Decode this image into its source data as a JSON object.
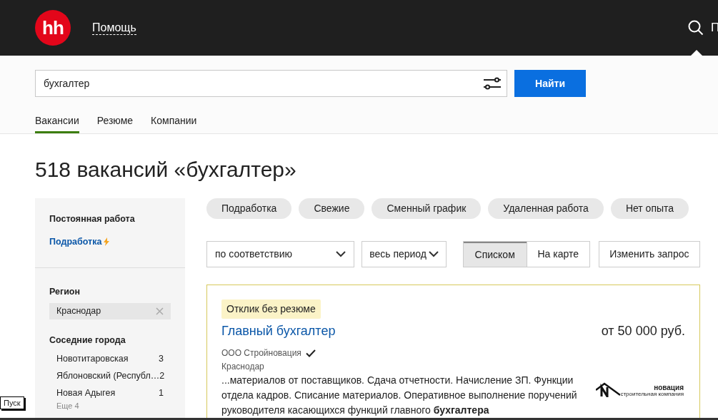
{
  "header": {
    "logo": "hh",
    "help_link": "Помощь",
    "cut_text": "П"
  },
  "search": {
    "value": "бухгалтер",
    "button": "Найти"
  },
  "tabs": [
    {
      "label": "Вакансии",
      "selected": true
    },
    {
      "label": "Резюме",
      "selected": false
    },
    {
      "label": "Компании",
      "selected": false
    }
  ],
  "title": "518 вакансий «бухгалтер»",
  "sidebar": {
    "employment_title": "Постоянная работа",
    "employment_link": "Подработка",
    "region_title": "Регион",
    "region_value": "Краснодар",
    "nearby_title": "Соседние города",
    "nearby": [
      {
        "name": "Новотитаровская",
        "count": "3"
      },
      {
        "name": "Яблоновский (Республ…",
        "count": "2"
      },
      {
        "name": "Новая Адыгея",
        "count": "1"
      }
    ],
    "more": "Еще 4"
  },
  "chips": [
    "Подработка",
    "Свежие",
    "Сменный график",
    "Удаленная работа",
    "Нет опыта"
  ],
  "sort": "по соответствию",
  "period": "весь период",
  "view": [
    {
      "label": "Списком",
      "selected": true
    },
    {
      "label": "На карте",
      "selected": false
    }
  ],
  "edit_button": "Изменить запрос",
  "vacancy": {
    "badge": "Отклик без резюме",
    "title": "Главный бухгалтер",
    "salary": "от 50 000 руб.",
    "company": "ООО Стройновация",
    "verified": true,
    "city": "Краснодар",
    "snippet": "...материалов от поставщиков. Сдача отчетности. Начисление ЗП. Функции отдела кадров. Списание материалов. Оперативное выполнение поручений руководителя касающихся функций главного **бухгалтера**",
    "logo_name": "новация",
    "logo_tagline": "строительная компания"
  },
  "taskbar": {
    "tooltip": "Пуск"
  }
}
